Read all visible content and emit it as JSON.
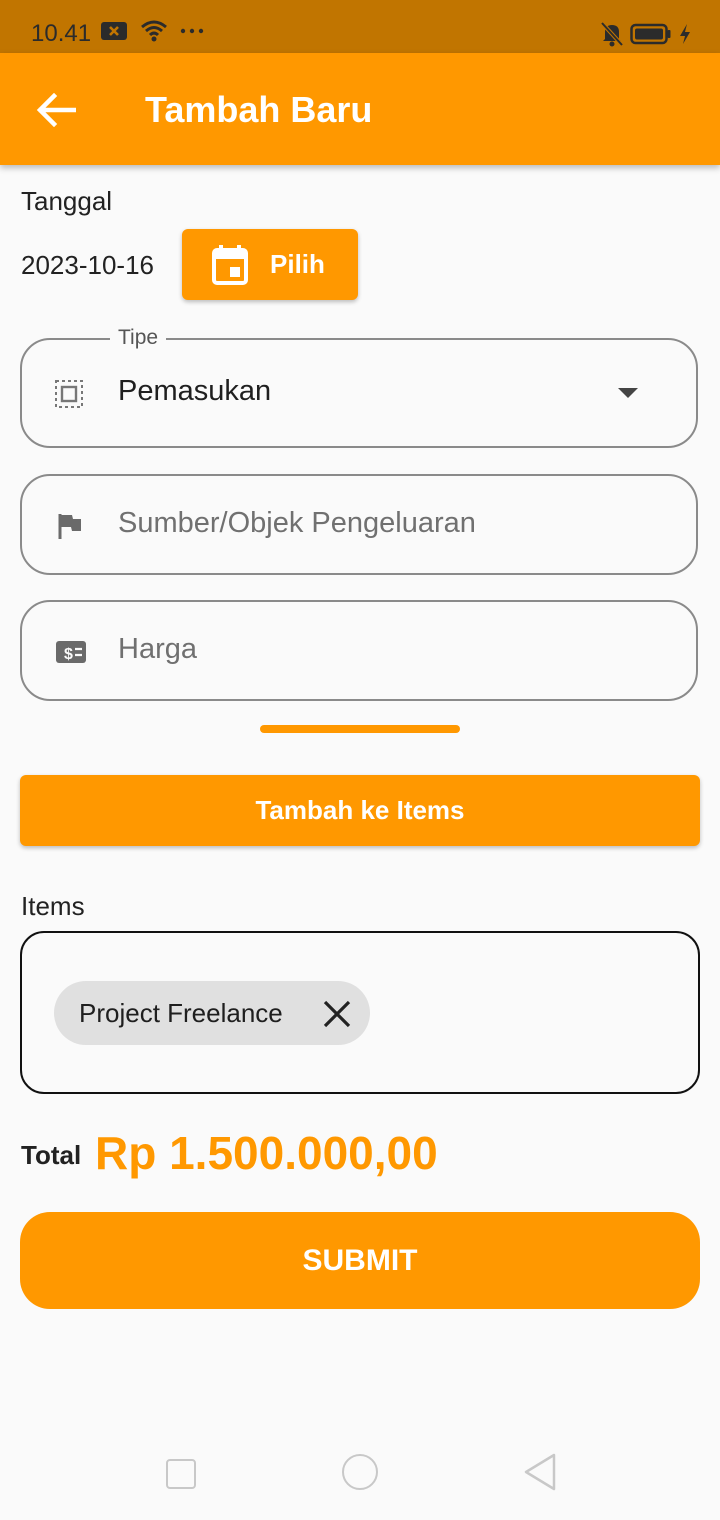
{
  "status_bar": {
    "time": "10.41",
    "icons": [
      "x-badge-icon",
      "wifi-icon",
      "more-dots-icon",
      "bell-off-icon",
      "battery-icon",
      "charging-icon"
    ]
  },
  "app_bar": {
    "title": "Tambah Baru",
    "back_icon": "arrow-left-icon"
  },
  "form": {
    "date_label": "Tanggal",
    "date_value": "2023-10-16",
    "pick_button_label": "Pilih",
    "type_field": {
      "legend": "Tipe",
      "value": "Pemasukan",
      "icon": "select-all-icon"
    },
    "source_field": {
      "placeholder": "Sumber/Objek Pengeluaran",
      "icon": "flag-icon"
    },
    "price_field": {
      "placeholder": "Harga",
      "icon": "price-tag-icon"
    },
    "add_button_label": "Tambah ke Items"
  },
  "items": {
    "label": "Items",
    "chips": [
      "Project Freelance"
    ]
  },
  "total": {
    "label": "Total",
    "value": "Rp 1.500.000,00"
  },
  "submit_label": "SUBMIT",
  "colors": {
    "primary": "#ff9800",
    "status_bar": "#c17500",
    "background": "#fafafa"
  }
}
